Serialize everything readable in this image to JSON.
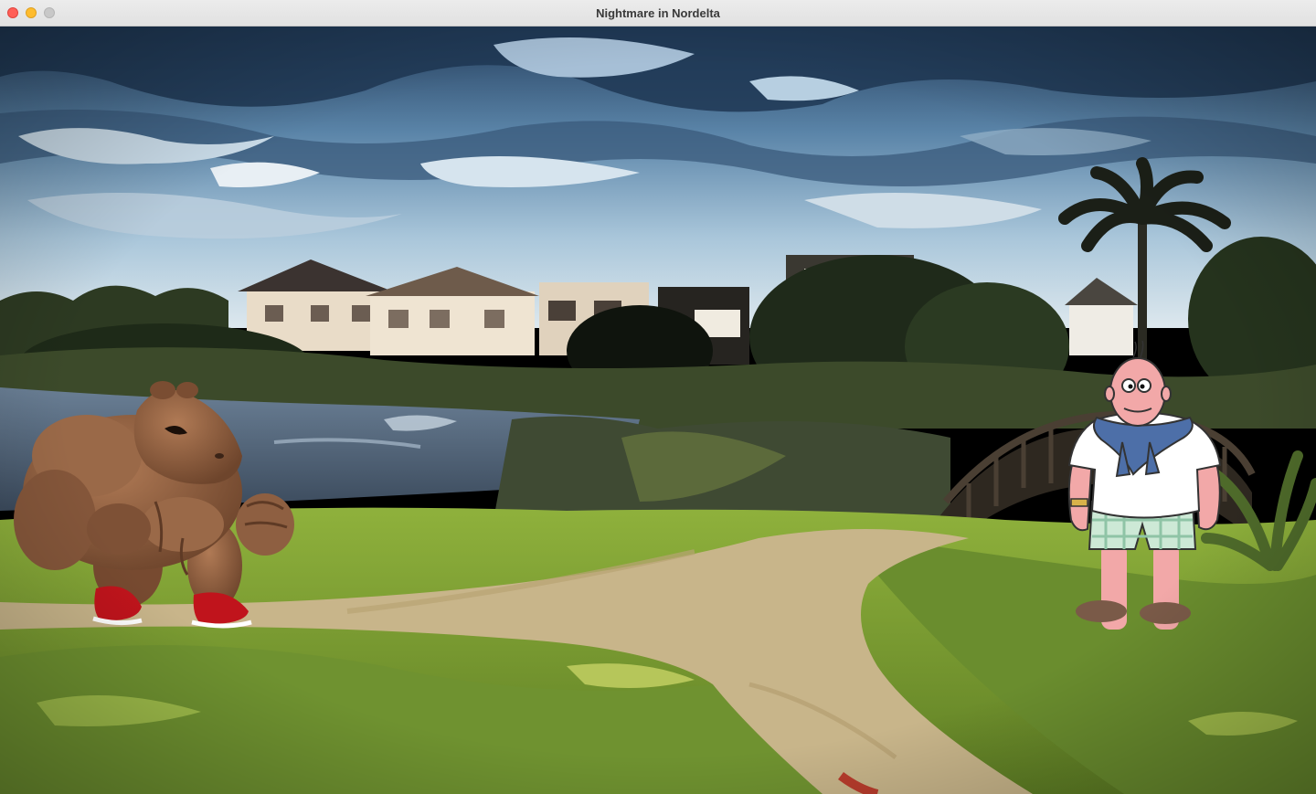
{
  "window": {
    "title": "Nightmare in Nordelta"
  },
  "scene": {
    "location_name": "Nordelta",
    "player_character": {
      "description": "muscular capybara with red sneakers",
      "facing": "right"
    },
    "opponent_character": {
      "description": "bald old man in white polo, blue sweater over shoulders, plaid shorts",
      "facing": "left"
    }
  },
  "colors": {
    "sky_top": "#2c4b6e",
    "sky_bottom": "#cfe0ea",
    "grass": "#7fa236",
    "grass_dark": "#4d6a22",
    "path": "#c9b78f",
    "water": "#53657a",
    "capybara": "#8b5a3c",
    "sneaker": "#c0141c",
    "polo": "#ffffff",
    "sweater": "#4d6fa8",
    "shorts": "#bfe6d0"
  }
}
